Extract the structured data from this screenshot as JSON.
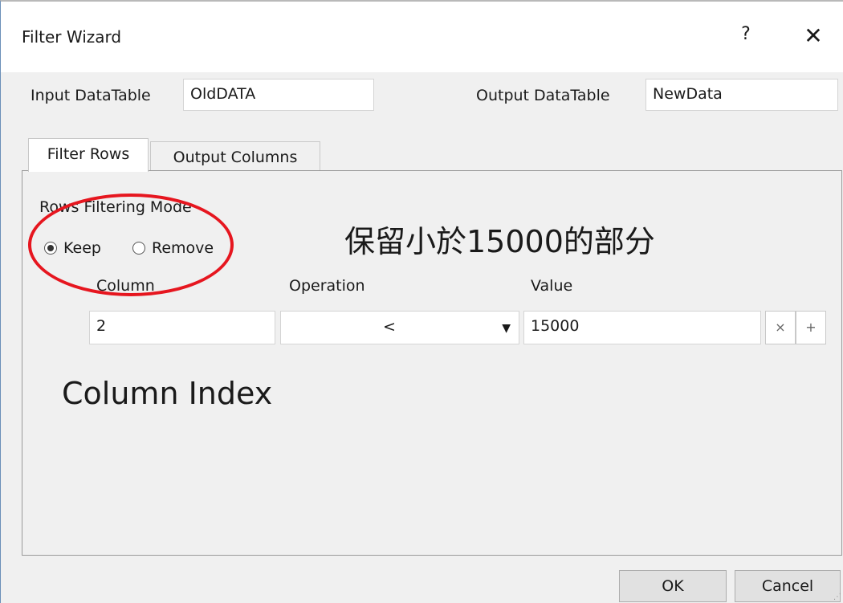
{
  "window": {
    "title": "Filter Wizard",
    "help": "?",
    "close": "✕"
  },
  "input_datatable": {
    "label": "Input DataTable",
    "value": "OldDATA"
  },
  "output_datatable": {
    "label": "Output DataTable",
    "value": "NewData"
  },
  "tabs": [
    {
      "label": "Filter Rows",
      "active": true
    },
    {
      "label": "Output Columns",
      "active": false
    }
  ],
  "filter": {
    "mode_label": "Rows Filtering Mode",
    "keep_label": "Keep",
    "remove_label": "Remove",
    "selected_mode": "Keep",
    "column_header": "Column",
    "operation_header": "Operation",
    "value_header": "Value",
    "row": {
      "column": "2",
      "operation": "<",
      "value": "15000"
    },
    "remove_row_icon": "×",
    "add_row_icon": "+",
    "dropdown_icon": "▼"
  },
  "annotations": {
    "chinese": "保留小於15000的部分",
    "column_index": "Column Index",
    "ellipse_color": "#e6161f"
  },
  "buttons": {
    "ok": "OK",
    "cancel": "Cancel"
  }
}
